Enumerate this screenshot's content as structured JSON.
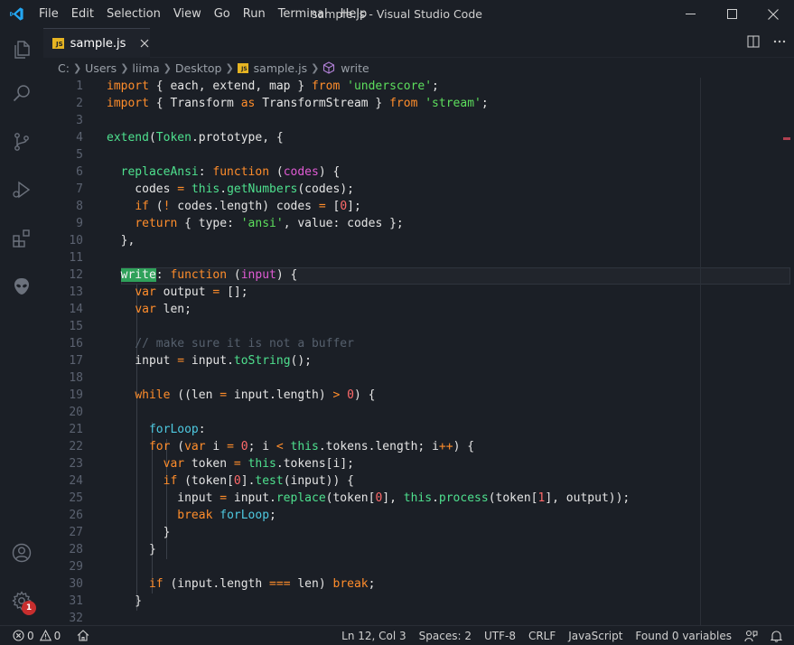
{
  "window": {
    "title": "sample.js - Visual Studio Code",
    "menu": [
      "File",
      "Edit",
      "Selection",
      "View",
      "Go",
      "Run",
      "Terminal",
      "Help"
    ]
  },
  "activity_bar": {
    "items": [
      "explorer-icon",
      "search-icon",
      "source-control-icon",
      "run-debug-icon",
      "extensions-icon",
      "alien-icon"
    ],
    "bottom": [
      "account-icon",
      "settings-gear-icon"
    ],
    "settings_badge": "1"
  },
  "tab": {
    "label": "sample.js",
    "icon_text": "JS"
  },
  "breadcrumb": [
    "C:",
    "Users",
    "liima",
    "Desktop",
    "sample.js",
    "write"
  ],
  "editor": {
    "lines": [
      {
        "n": "1",
        "tokens": [
          [
            "kw",
            "import"
          ],
          [
            "t",
            " { each, extend, map } "
          ],
          [
            "kw",
            "from"
          ],
          [
            "t",
            " "
          ],
          [
            "str",
            "'underscore'"
          ],
          [
            "t",
            ";"
          ]
        ]
      },
      {
        "n": "2",
        "tokens": [
          [
            "kw",
            "import"
          ],
          [
            "t",
            " { Transform "
          ],
          [
            "kw",
            "as"
          ],
          [
            "t",
            " TransformStream } "
          ],
          [
            "kw",
            "from"
          ],
          [
            "t",
            " "
          ],
          [
            "str",
            "'stream'"
          ],
          [
            "t",
            ";"
          ]
        ]
      },
      {
        "n": "3",
        "tokens": []
      },
      {
        "n": "4",
        "tokens": [
          [
            "fn",
            "extend"
          ],
          [
            "t",
            "("
          ],
          [
            "fn",
            "Token"
          ],
          [
            "t",
            "."
          ],
          [
            "t",
            "prototype, {"
          ]
        ]
      },
      {
        "n": "5",
        "tokens": []
      },
      {
        "n": "6",
        "tokens": [
          [
            "t",
            "  "
          ],
          [
            "fn",
            "replaceAnsi"
          ],
          [
            "t",
            ": "
          ],
          [
            "kw",
            "function"
          ],
          [
            "t",
            " ("
          ],
          [
            "param",
            "codes"
          ],
          [
            "t",
            ") {"
          ]
        ]
      },
      {
        "n": "7",
        "tokens": [
          [
            "t",
            "    codes "
          ],
          [
            "kw",
            "="
          ],
          [
            "t",
            " "
          ],
          [
            "fn",
            "this"
          ],
          [
            "t",
            "."
          ],
          [
            "fn",
            "getNumbers"
          ],
          [
            "t",
            "(codes);"
          ]
        ]
      },
      {
        "n": "8",
        "tokens": [
          [
            "t",
            "    "
          ],
          [
            "kw",
            "if"
          ],
          [
            "t",
            " ("
          ],
          [
            "kw",
            "!"
          ],
          [
            "t",
            " codes"
          ],
          [
            "t",
            "."
          ],
          [
            "t",
            "length) codes "
          ],
          [
            "kw",
            "="
          ],
          [
            "t",
            " ["
          ],
          [
            "num",
            "0"
          ],
          [
            "t",
            "];"
          ]
        ]
      },
      {
        "n": "9",
        "tokens": [
          [
            "t",
            "    "
          ],
          [
            "kw",
            "return"
          ],
          [
            "t",
            " { type: "
          ],
          [
            "str",
            "'ansi'"
          ],
          [
            "t",
            ", value: codes };"
          ]
        ]
      },
      {
        "n": "10",
        "tokens": [
          [
            "t",
            "  },"
          ]
        ]
      },
      {
        "n": "11",
        "tokens": []
      },
      {
        "n": "12",
        "tokens": [
          [
            "t",
            "  "
          ],
          [
            "hl",
            "write"
          ],
          [
            "t",
            ": "
          ],
          [
            "kw",
            "function"
          ],
          [
            "t",
            " ("
          ],
          [
            "param",
            "input"
          ],
          [
            "t",
            ") {"
          ]
        ]
      },
      {
        "n": "13",
        "tokens": [
          [
            "t",
            "    "
          ],
          [
            "kw",
            "var"
          ],
          [
            "t",
            " output "
          ],
          [
            "kw",
            "="
          ],
          [
            "t",
            " [];"
          ]
        ]
      },
      {
        "n": "14",
        "tokens": [
          [
            "t",
            "    "
          ],
          [
            "kw",
            "var"
          ],
          [
            "t",
            " len;"
          ]
        ]
      },
      {
        "n": "15",
        "tokens": []
      },
      {
        "n": "16",
        "tokens": [
          [
            "t",
            "    "
          ],
          [
            "cm",
            "// make sure it is not a buffer"
          ]
        ]
      },
      {
        "n": "17",
        "tokens": [
          [
            "t",
            "    input "
          ],
          [
            "kw",
            "="
          ],
          [
            "t",
            " input"
          ],
          [
            "t",
            "."
          ],
          [
            "fn",
            "toString"
          ],
          [
            "t",
            "();"
          ]
        ]
      },
      {
        "n": "18",
        "tokens": []
      },
      {
        "n": "19",
        "tokens": [
          [
            "t",
            "    "
          ],
          [
            "kw",
            "while"
          ],
          [
            "t",
            " ((len "
          ],
          [
            "kw",
            "="
          ],
          [
            "t",
            " input"
          ],
          [
            "t",
            "."
          ],
          [
            "t",
            "length) "
          ],
          [
            "kw",
            ">"
          ],
          [
            "t",
            " "
          ],
          [
            "num",
            "0"
          ],
          [
            "t",
            ") {"
          ]
        ]
      },
      {
        "n": "20",
        "tokens": []
      },
      {
        "n": "21",
        "tokens": [
          [
            "t",
            "      "
          ],
          [
            "lbl",
            "forLoop"
          ],
          [
            "t",
            ":"
          ]
        ]
      },
      {
        "n": "22",
        "tokens": [
          [
            "t",
            "      "
          ],
          [
            "kw",
            "for"
          ],
          [
            "t",
            " ("
          ],
          [
            "kw",
            "var"
          ],
          [
            "t",
            " i "
          ],
          [
            "kw",
            "="
          ],
          [
            "t",
            " "
          ],
          [
            "num",
            "0"
          ],
          [
            "t",
            "; i "
          ],
          [
            "kw",
            "<"
          ],
          [
            "t",
            " "
          ],
          [
            "fn",
            "this"
          ],
          [
            "t",
            "."
          ],
          [
            "t",
            "tokens"
          ],
          [
            "t",
            "."
          ],
          [
            "t",
            "length; i"
          ],
          [
            "kw",
            "++"
          ],
          [
            "t",
            ") {"
          ]
        ]
      },
      {
        "n": "23",
        "tokens": [
          [
            "t",
            "        "
          ],
          [
            "kw",
            "var"
          ],
          [
            "t",
            " token "
          ],
          [
            "kw",
            "="
          ],
          [
            "t",
            " "
          ],
          [
            "fn",
            "this"
          ],
          [
            "t",
            "."
          ],
          [
            "t",
            "tokens[i];"
          ]
        ]
      },
      {
        "n": "24",
        "tokens": [
          [
            "t",
            "        "
          ],
          [
            "kw",
            "if"
          ],
          [
            "t",
            " (token["
          ],
          [
            "num",
            "0"
          ],
          [
            "t",
            "]"
          ],
          [
            "t",
            "."
          ],
          [
            "fn",
            "test"
          ],
          [
            "t",
            "(input)) {"
          ]
        ]
      },
      {
        "n": "25",
        "tokens": [
          [
            "t",
            "          input "
          ],
          [
            "kw",
            "="
          ],
          [
            "t",
            " input"
          ],
          [
            "t",
            "."
          ],
          [
            "fn",
            "replace"
          ],
          [
            "t",
            "(token["
          ],
          [
            "num",
            "0"
          ],
          [
            "t",
            "], "
          ],
          [
            "fn",
            "this"
          ],
          [
            "t",
            "."
          ],
          [
            "fn",
            "process"
          ],
          [
            "t",
            "(token["
          ],
          [
            "num",
            "1"
          ],
          [
            "t",
            "], output));"
          ]
        ]
      },
      {
        "n": "26",
        "tokens": [
          [
            "t",
            "          "
          ],
          [
            "kw",
            "break"
          ],
          [
            "t",
            " "
          ],
          [
            "lbl",
            "forLoop"
          ],
          [
            "t",
            ";"
          ]
        ]
      },
      {
        "n": "27",
        "tokens": [
          [
            "t",
            "        }"
          ]
        ]
      },
      {
        "n": "28",
        "tokens": [
          [
            "t",
            "      }"
          ]
        ]
      },
      {
        "n": "29",
        "tokens": []
      },
      {
        "n": "30",
        "tokens": [
          [
            "t",
            "      "
          ],
          [
            "kw",
            "if"
          ],
          [
            "t",
            " (input"
          ],
          [
            "t",
            "."
          ],
          [
            "t",
            "length "
          ],
          [
            "kw",
            "==="
          ],
          [
            "t",
            " len) "
          ],
          [
            "kw",
            "break"
          ],
          [
            "t",
            ";"
          ]
        ]
      },
      {
        "n": "31",
        "tokens": [
          [
            "t",
            "    }"
          ]
        ]
      },
      {
        "n": "32",
        "tokens": []
      }
    ]
  },
  "status_bar": {
    "errors": "0",
    "warnings": "0",
    "position": "Ln 12, Col 3",
    "spaces": "Spaces: 2",
    "encoding": "UTF-8",
    "eol": "CRLF",
    "language": "JavaScript",
    "variables": "Found 0 variables"
  },
  "colors": {
    "background": "#1b1f26",
    "keyword": "#ff8d2b",
    "string": "#5ddf5d",
    "function": "#4ee08e",
    "parameter": "#e05bd4",
    "number": "#ff6a6a",
    "comment": "#56606d",
    "label": "#4ec9e0",
    "vscode_blue": "#23a6f2"
  }
}
